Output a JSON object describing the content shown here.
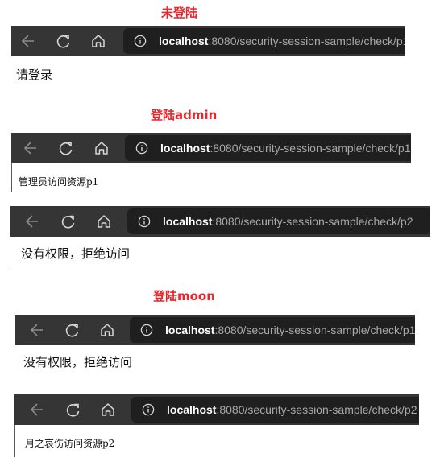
{
  "sections": {
    "not_logged_in": {
      "heading": "未登陆"
    },
    "admin": {
      "heading": "登陆admin"
    },
    "moon": {
      "heading": "登陆moon"
    }
  },
  "browser": {
    "icons": [
      "back-arrow-icon",
      "reload-icon",
      "home-icon",
      "info-icon"
    ],
    "url_host": "localhost",
    "colors": {
      "bar": "#353535",
      "url_box": "#1f1f1f",
      "host_text": "#ffffff",
      "path_text": "#a9a9a9",
      "heading": "#e8262b"
    }
  },
  "windows": [
    {
      "url_rest": ":8080/security-session-sample/check/p1",
      "body_text": "请登录"
    },
    {
      "url_rest": ":8080/security-session-sample/check/p1",
      "body_text": "管理员访问资源p1"
    },
    {
      "url_rest": ":8080/security-session-sample/check/p2",
      "body_text": "没有权限，拒绝访问"
    },
    {
      "url_rest": ":8080/security-session-sample/check/p1",
      "body_text": "没有权限，拒绝访问"
    },
    {
      "url_rest": ":8080/security-session-sample/check/p2",
      "body_text": "月之哀伤访问资源p2"
    }
  ]
}
